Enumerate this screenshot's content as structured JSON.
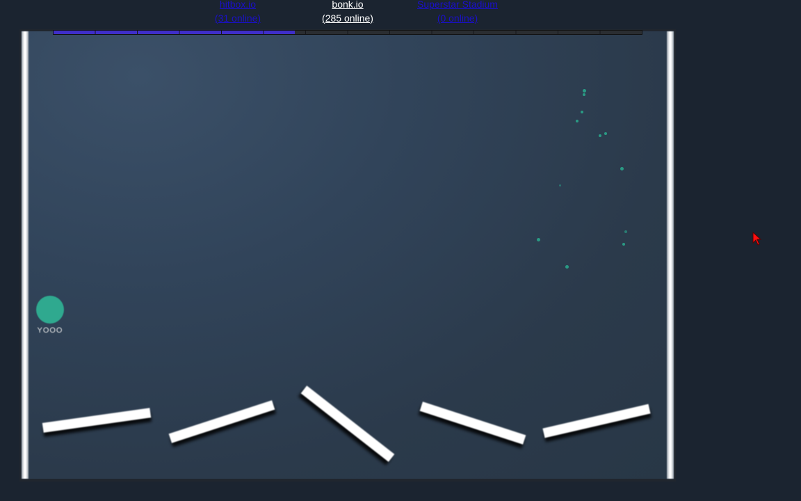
{
  "nav": {
    "links": [
      {
        "name": "hitbox.io",
        "online": "(31 online)"
      },
      {
        "name": "bonk.io",
        "online": "(285 online)"
      },
      {
        "name": "Superstar Stadium",
        "online": "(0 online)"
      }
    ]
  },
  "player": {
    "name": "YOOO",
    "color": "#2fa98f"
  },
  "progress": {
    "fraction": 0.41
  },
  "colors": {
    "background": "#1b2430",
    "arena": "#2e3f52",
    "platform": "#ffffff",
    "progress_fill": "#3f2ec8",
    "link": "#1a10c8"
  },
  "cursor": {
    "icon": "red-arrow-cursor-icon"
  }
}
